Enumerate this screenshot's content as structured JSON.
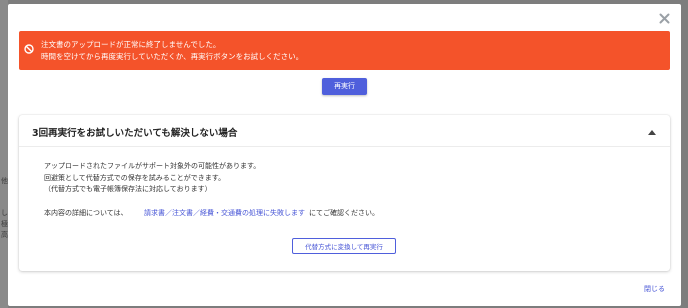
{
  "background": {
    "peek_text_1": "他",
    "peek_text_2": "し",
    "peek_text_3": "極",
    "peek_text_4": "高"
  },
  "modal": {
    "close_icon": "close-icon"
  },
  "alert": {
    "icon": "block-icon",
    "line1": "注文書のアップロードが正常に終了しませんでした。",
    "line2": "時間を空けてから再度実行していただくか、再実行ボタンをお試しください。",
    "color": "#f4532a"
  },
  "retry_button": {
    "label": "再実行",
    "color": "#4f5fdc"
  },
  "card": {
    "title": "3回再実行をお試しいただいても解決しない場合",
    "collapse_icon": "caret-up-icon",
    "line1": "アップロードされたファイルがサポート対象外の可能性があります。",
    "line2": "回避策として代替方式での保存を試みることができます。",
    "line3": "（代替方式でも電子帳簿保存法に対応しております）",
    "detail_prefix": "本内容の詳細については、",
    "detail_link": "請求書／注文書／経費・交通費の処理に失敗します",
    "detail_suffix": "にてご確認ください。",
    "alt_button": "代替方式に変換して再実行",
    "link_color": "#4654d6"
  },
  "footer": {
    "close_label": "閉じる"
  }
}
